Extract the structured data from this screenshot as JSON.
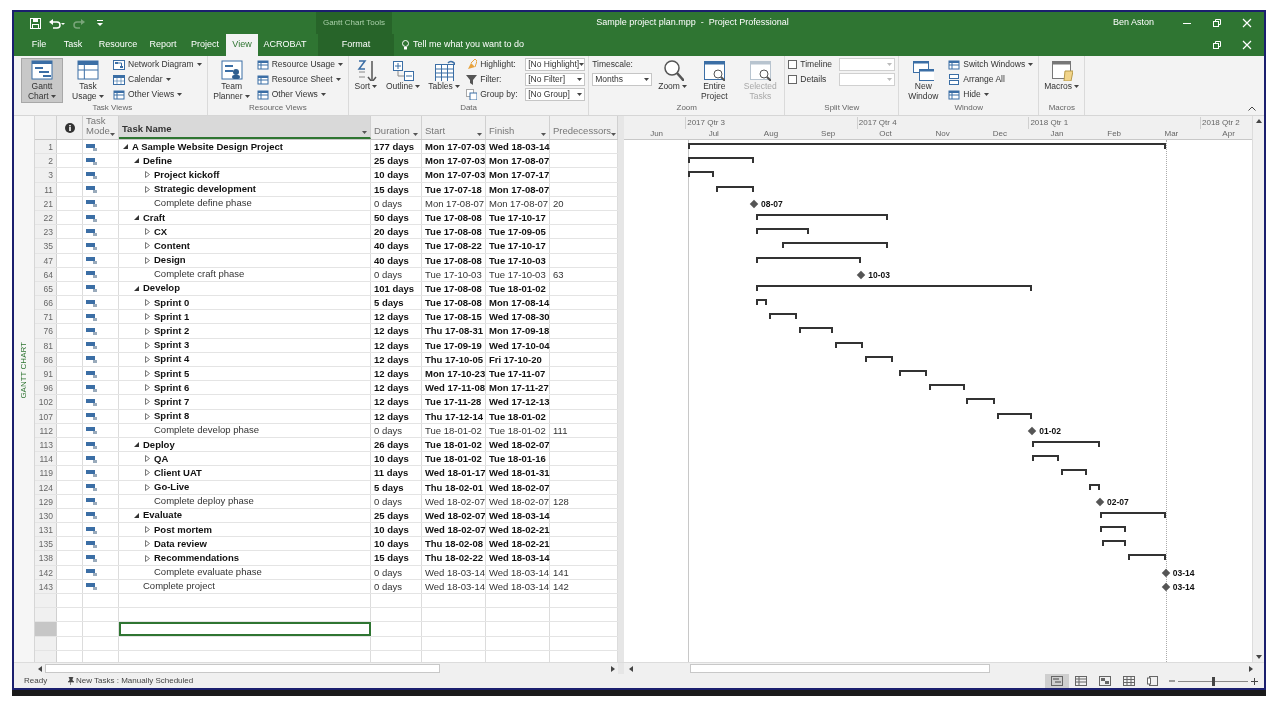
{
  "title_bar": {
    "context_label": "Gantt Chart Tools",
    "title": "Sample project plan.mpp  -  Project Professional",
    "user": "Ben Aston"
  },
  "tabs": [
    {
      "label": "File",
      "selected": false,
      "kind": "normal"
    },
    {
      "label": "Task",
      "selected": false,
      "kind": "normal"
    },
    {
      "label": "Resource",
      "selected": false,
      "kind": "normal"
    },
    {
      "label": "Report",
      "selected": false,
      "kind": "normal"
    },
    {
      "label": "Project",
      "selected": false,
      "kind": "normal"
    },
    {
      "label": "View",
      "selected": true,
      "kind": "normal"
    },
    {
      "label": "ACROBAT",
      "selected": false,
      "kind": "normal"
    },
    {
      "label": "Format",
      "selected": false,
      "kind": "contextual"
    }
  ],
  "tell_me": "Tell me what you want to do",
  "ribbon": [
    {
      "label": "Task Views",
      "items": [
        {
          "kind": "large",
          "label": "Gantt Chart",
          "menu": true,
          "selected": true
        },
        {
          "kind": "large",
          "label": "Task Usage",
          "menu": true,
          "selected": false
        },
        {
          "kind": "small",
          "label": "Network Diagram",
          "menu": true
        },
        {
          "kind": "small",
          "label": "Calendar",
          "menu": true
        },
        {
          "kind": "small",
          "label": "Other Views",
          "menu": true
        }
      ]
    },
    {
      "label": "Resource Views",
      "items": [
        {
          "kind": "large",
          "label": "Team Planner",
          "menu": true
        },
        {
          "kind": "small",
          "label": "Resource Usage",
          "menu": true
        },
        {
          "kind": "small",
          "label": "Resource Sheet",
          "menu": true
        },
        {
          "kind": "small",
          "label": "Other Views",
          "menu": true
        }
      ]
    },
    {
      "label": "Data",
      "items": [
        {
          "kind": "large",
          "label": "Sort",
          "menu": true
        },
        {
          "kind": "large",
          "label": "Outline",
          "menu": true
        },
        {
          "kind": "large",
          "label": "Tables",
          "menu": true
        },
        {
          "kind": "field",
          "label": "Highlight:",
          "value": "[No Highlight]"
        },
        {
          "kind": "field",
          "label": "Filter:",
          "value": "[No Filter]"
        },
        {
          "kind": "field",
          "label": "Group by:",
          "value": "[No Group]"
        }
      ]
    },
    {
      "label": "Zoom",
      "items": [
        {
          "kind": "field_stacked",
          "label": "Timescale:",
          "value": "Months",
          "disabled": false
        },
        {
          "kind": "large",
          "label": "Zoom",
          "menu": true,
          "disabled": false
        },
        {
          "kind": "large",
          "label": "Entire Project",
          "menu": false,
          "disabled": false
        },
        {
          "kind": "large",
          "label": "Selected Tasks",
          "menu": false,
          "disabled": true
        }
      ]
    },
    {
      "label": "Split View",
      "items": [
        {
          "kind": "check",
          "label": "Timeline",
          "checked": false
        },
        {
          "kind": "check",
          "label": "Details",
          "checked": false
        }
      ]
    },
    {
      "label": "Window",
      "items": [
        {
          "kind": "large",
          "label": "New Window",
          "menu": false
        },
        {
          "kind": "small",
          "label": "Switch Windows",
          "menu": true
        },
        {
          "kind": "small",
          "label": "Arrange All",
          "menu": false
        },
        {
          "kind": "small",
          "label": "Hide",
          "menu": true
        }
      ]
    },
    {
      "label": "Macros",
      "items": [
        {
          "kind": "large",
          "label": "Macros",
          "menu": true
        }
      ]
    }
  ],
  "side_label": "GANTT CHART",
  "table": {
    "columns": [
      "Task Mode",
      "Task Name",
      "Duration",
      "Start",
      "Finish",
      "Predecessors"
    ],
    "tasks": [
      {
        "id": "1",
        "name": "A Sample Website Design Project",
        "duration": "177 days",
        "start": "Mon 17-07-03",
        "finish": "Wed 18-03-14",
        "kind": "summary",
        "expanded": true,
        "children": [
          {
            "id": "2",
            "name": "Define",
            "duration": "25 days",
            "start": "Mon 17-07-03",
            "finish": "Mon 17-08-07",
            "kind": "summary",
            "expanded": true,
            "children": [
              {
                "id": "3",
                "name": "Project kickoff",
                "duration": "10 days",
                "start": "Mon 17-07-03",
                "finish": "Mon 17-07-17",
                "kind": "summary",
                "expanded": false
              },
              {
                "id": "11",
                "name": "Strategic development",
                "duration": "15 days",
                "start": "Tue 17-07-18",
                "finish": "Mon 17-08-07",
                "kind": "summary",
                "expanded": false
              },
              {
                "id": "21",
                "name": "Complete define phase",
                "duration": "0 days",
                "start": "Mon 17-08-07",
                "finish": "Mon 17-08-07",
                "predecessors": "20",
                "kind": "milestone",
                "gantt_label": "08-07"
              }
            ]
          },
          {
            "id": "22",
            "name": "Craft",
            "duration": "50 days",
            "start": "Tue 17-08-08",
            "finish": "Tue 17-10-17",
            "kind": "summary",
            "expanded": true,
            "children": [
              {
                "id": "23",
                "name": "CX",
                "duration": "20 days",
                "start": "Tue 17-08-08",
                "finish": "Tue 17-09-05",
                "kind": "summary",
                "expanded": false
              },
              {
                "id": "35",
                "name": "Content",
                "duration": "40 days",
                "start": "Tue 17-08-22",
                "finish": "Tue 17-10-17",
                "kind": "summary",
                "expanded": false
              },
              {
                "id": "47",
                "name": "Design",
                "duration": "40 days",
                "start": "Tue 17-08-08",
                "finish": "Tue 17-10-03",
                "kind": "summary",
                "expanded": false
              },
              {
                "id": "64",
                "name": "Complete craft phase",
                "duration": "0 days",
                "start": "Tue 17-10-03",
                "finish": "Tue 17-10-03",
                "predecessors": "63",
                "kind": "milestone",
                "gantt_label": "10-03"
              }
            ]
          },
          {
            "id": "65",
            "name": "Develop",
            "duration": "101 days",
            "start": "Tue 17-08-08",
            "finish": "Tue 18-01-02",
            "kind": "summary",
            "expanded": true,
            "children": [
              {
                "id": "66",
                "name": "Sprint 0",
                "duration": "5 days",
                "start": "Tue 17-08-08",
                "finish": "Mon 17-08-14",
                "kind": "summary",
                "expanded": false
              },
              {
                "id": "71",
                "name": "Sprint 1",
                "duration": "12 days",
                "start": "Tue 17-08-15",
                "finish": "Wed 17-08-30",
                "kind": "summary",
                "expanded": false
              },
              {
                "id": "76",
                "name": "Sprint 2",
                "duration": "12 days",
                "start": "Thu 17-08-31",
                "finish": "Mon 17-09-18",
                "kind": "summary",
                "expanded": false
              },
              {
                "id": "81",
                "name": "Sprint 3",
                "duration": "12 days",
                "start": "Tue 17-09-19",
                "finish": "Wed 17-10-04",
                "kind": "summary",
                "expanded": false
              },
              {
                "id": "86",
                "name": "Sprint 4",
                "duration": "12 days",
                "start": "Thu 17-10-05",
                "finish": "Fri 17-10-20",
                "kind": "summary",
                "expanded": false
              },
              {
                "id": "91",
                "name": "Sprint 5",
                "duration": "12 days",
                "start": "Mon 17-10-23",
                "finish": "Tue 17-11-07",
                "kind": "summary",
                "expanded": false
              },
              {
                "id": "96",
                "name": "Sprint 6",
                "duration": "12 days",
                "start": "Wed 17-11-08",
                "finish": "Mon 17-11-27",
                "kind": "summary",
                "expanded": false
              },
              {
                "id": "102",
                "name": "Sprint 7",
                "duration": "12 days",
                "start": "Tue 17-11-28",
                "finish": "Wed 17-12-13",
                "kind": "summary",
                "expanded": false
              },
              {
                "id": "107",
                "name": "Sprint 8",
                "duration": "12 days",
                "start": "Thu 17-12-14",
                "finish": "Tue 18-01-02",
                "kind": "summary",
                "expanded": false
              },
              {
                "id": "112",
                "name": "Complete develop phase",
                "duration": "0 days",
                "start": "Tue 18-01-02",
                "finish": "Tue 18-01-02",
                "predecessors": "111",
                "kind": "milestone",
                "gantt_label": "01-02"
              }
            ]
          },
          {
            "id": "113",
            "name": "Deploy",
            "duration": "26 days",
            "start": "Tue 18-01-02",
            "finish": "Wed 18-02-07",
            "kind": "summary",
            "expanded": true,
            "children": [
              {
                "id": "114",
                "name": "QA",
                "duration": "10 days",
                "start": "Tue 18-01-02",
                "finish": "Tue 18-01-16",
                "kind": "summary",
                "expanded": false
              },
              {
                "id": "119",
                "name": "Client UAT",
                "duration": "11 days",
                "start": "Wed 18-01-17",
                "finish": "Wed 18-01-31",
                "kind": "summary",
                "expanded": false
              },
              {
                "id": "124",
                "name": "Go-Live",
                "duration": "5 days",
                "start": "Thu 18-02-01",
                "finish": "Wed 18-02-07",
                "kind": "summary",
                "expanded": false
              },
              {
                "id": "129",
                "name": "Complete deploy phase",
                "duration": "0 days",
                "start": "Wed 18-02-07",
                "finish": "Wed 18-02-07",
                "predecessors": "128",
                "kind": "milestone",
                "gantt_label": "02-07"
              }
            ]
          },
          {
            "id": "130",
            "name": "Evaluate",
            "duration": "25 days",
            "start": "Wed 18-02-07",
            "finish": "Wed 18-03-14",
            "kind": "summary",
            "expanded": true,
            "children": [
              {
                "id": "131",
                "name": "Post mortem",
                "duration": "10 days",
                "start": "Wed 18-02-07",
                "finish": "Wed 18-02-21",
                "kind": "summary",
                "expanded": false
              },
              {
                "id": "135",
                "name": "Data review",
                "duration": "10 days",
                "start": "Thu 18-02-08",
                "finish": "Wed 18-02-21",
                "kind": "summary",
                "expanded": false
              },
              {
                "id": "138",
                "name": "Recommendations",
                "duration": "15 days",
                "start": "Thu 18-02-22",
                "finish": "Wed 18-03-14",
                "kind": "summary",
                "expanded": false
              },
              {
                "id": "142",
                "name": "Complete evaluate phase",
                "duration": "0 days",
                "start": "Wed 18-03-14",
                "finish": "Wed 18-03-14",
                "predecessors": "141",
                "kind": "milestone",
                "gantt_label": "03-14"
              }
            ]
          },
          {
            "id": "143",
            "name": "Complete project",
            "duration": "0 days",
            "start": "Wed 18-03-14",
            "finish": "Wed 18-03-14",
            "predecessors": "142",
            "kind": "milestone",
            "gantt_label": "03-14"
          }
        ]
      }
    ],
    "blank_rows": [
      {
        "selected": false
      },
      {
        "selected": false
      },
      {
        "selected": true
      },
      {
        "selected": false
      },
      {
        "selected": false
      }
    ]
  },
  "timescale": {
    "quarters": [
      "2017 Qtr 3",
      "2017 Qtr 4",
      "2018 Qtr 1",
      "2018 Qtr 2"
    ],
    "months": [
      "Jun",
      "Jul",
      "Aug",
      "Sep",
      "Oct",
      "Nov",
      "Dec",
      "Jan",
      "Feb",
      "Mar",
      "Apr"
    ]
  },
  "status_bar": {
    "ready": "Ready",
    "new_tasks": "New Tasks : Manually Scheduled",
    "views": [
      {
        "selected": true
      },
      {
        "selected": false
      },
      {
        "selected": false
      },
      {
        "selected": false
      },
      {
        "selected": false
      }
    ],
    "zoom": {
      "level": 0.5
    }
  }
}
